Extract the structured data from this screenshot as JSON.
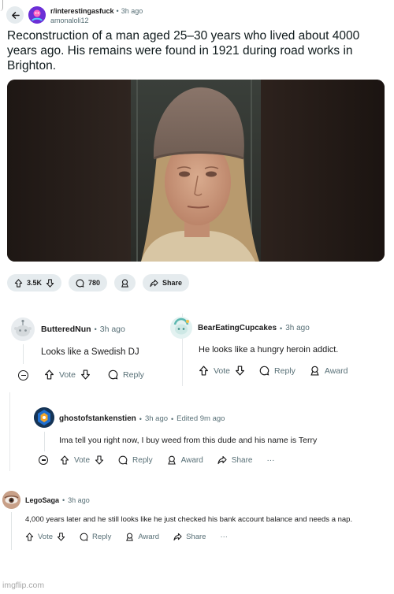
{
  "post": {
    "subreddit": "r/interestingasfuck",
    "time": "3h ago",
    "author": "amonaloli12",
    "title": "Reconstruction of a man aged 25–30 years who lived about 4000 years ago. His remains were found in 1921 during road works in Brighton.",
    "upvotes": "3.5K",
    "comments": "780",
    "share_label": "Share"
  },
  "comments": [
    {
      "author": "ButteredNun",
      "time": "3h ago",
      "text": "Looks like a Swedish DJ",
      "vote": "Vote",
      "reply": "Reply"
    },
    {
      "author": "BearEatingCupcakes",
      "time": "3h ago",
      "text": "He looks like a hungry heroin addict.",
      "vote": "Vote",
      "reply": "Reply",
      "award": "Award"
    },
    {
      "author": "ghostofstankenstien",
      "time": "3h ago",
      "edited": "Edited 9m ago",
      "text": "Ima tell you right now, I buy weed from this dude and his name is Terry",
      "vote": "Vote",
      "reply": "Reply",
      "award": "Award",
      "share": "Share",
      "more": "···"
    },
    {
      "author": "LegoSaga",
      "time": "3h ago",
      "text": "4,000 years later and he still looks like he just checked his bank account balance and needs a nap.",
      "vote": "Vote",
      "reply": "Reply",
      "award": "Award",
      "share": "Share",
      "more": "···"
    }
  ],
  "watermark": "imgflip.com",
  "dot": "•",
  "colors": {
    "pill_bg": "#e5ebee",
    "meta": "#576f76",
    "subreddit_icon": "#7b3fe4"
  }
}
